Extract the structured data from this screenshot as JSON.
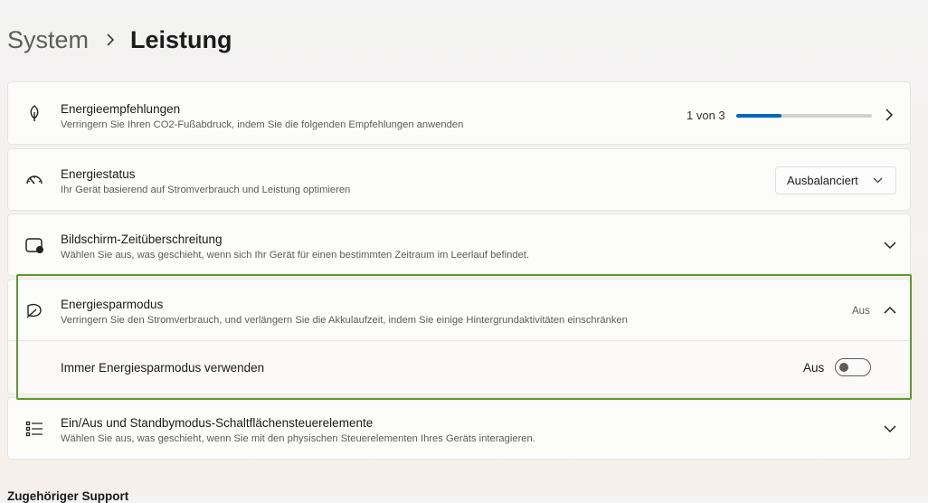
{
  "breadcrumb": {
    "parent": "System",
    "current": "Leistung"
  },
  "cards": {
    "recommendations": {
      "title": "Energieempfehlungen",
      "description": "Verringern Sie Ihren CO2-Fußabdruck, indem Sie die folgenden Empfehlungen anwenden",
      "progress_label": "1 von 3",
      "progress_fraction": 0.333,
      "icon": "leaf-icon"
    },
    "power_status": {
      "title": "Energiestatus",
      "description": "Ihr Gerät basierend auf Stromverbrauch und Leistung optimieren",
      "dropdown_value": "Ausbalanciert",
      "icon": "gauge-icon"
    },
    "screen_timeout": {
      "title": "Bildschirm-Zeitüberschreitung",
      "description": "Wählen Sie aus, was geschieht, wenn sich Ihr Gerät für einen bestimmten Zeitraum im Leerlauf befindet.",
      "icon": "screen-timeout-icon"
    },
    "energy_saver": {
      "title": "Energiesparmodus",
      "description": "Verringern Sie den Stromverbrauch, und verlängern Sie die Akkulaufzeit, indem Sie einige Hintergrundaktivitäten einschränken",
      "status": "Aus",
      "icon": "energy-saver-leaf-icon",
      "sub_setting": {
        "label": "Immer Energiesparmodus verwenden",
        "toggle_label": "Aus",
        "toggle_on": false
      }
    },
    "power_buttons": {
      "title": "Ein/Aus und Standbymodus-Schaltflächensteuerelemente",
      "description": "Wählen Sie aus, was geschieht, wenn Sie mit den physischen Steuerelementen Ihres Geräts interagieren.",
      "icon": "list-icon"
    }
  },
  "related_support": {
    "title": "Zugehöriger Support"
  },
  "colors": {
    "accent": "#0067c0",
    "highlight": "#5e9a2a"
  }
}
